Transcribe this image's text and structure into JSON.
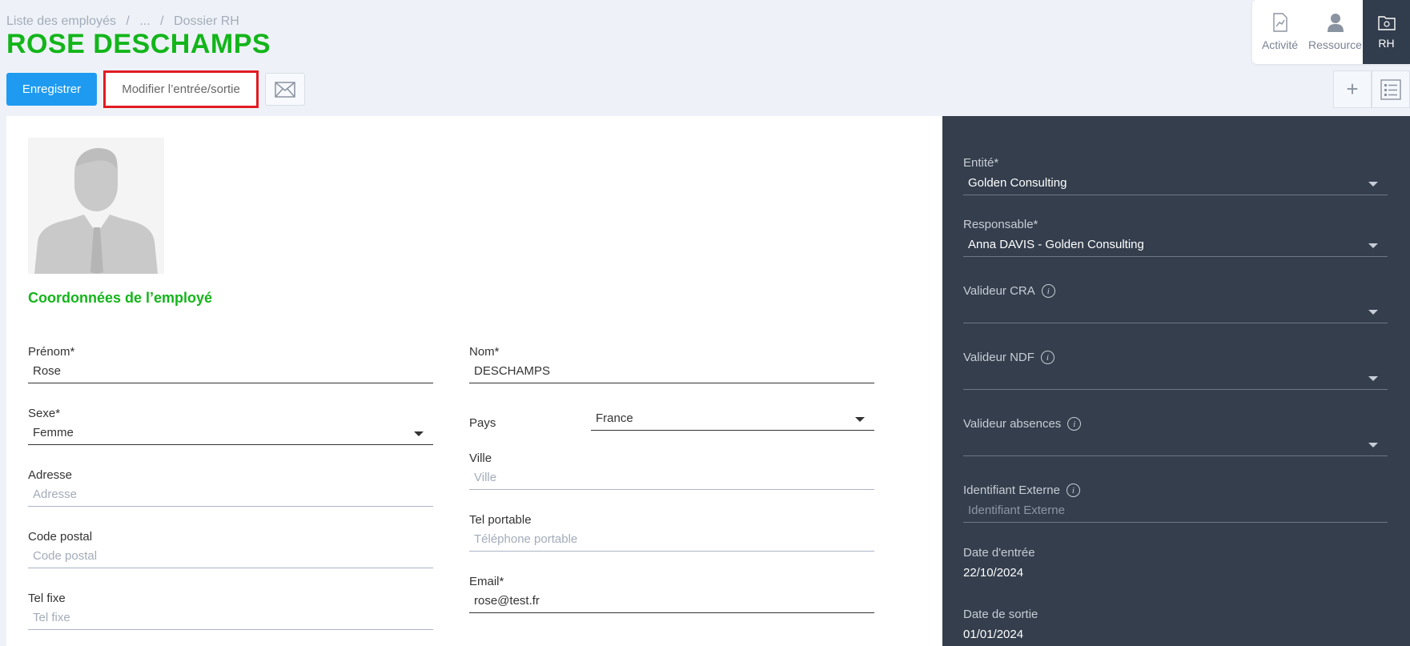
{
  "breadcrumb": {
    "item1": "Liste des employés",
    "sep1": "/",
    "item2": "...",
    "sep2": "/",
    "item3": "Dossier RH"
  },
  "page_title": "ROSE DESCHAMPS",
  "toolbar": {
    "save_label": "Enregistrer",
    "edit_label": "Modifier l’entrée/sortie"
  },
  "topnav": {
    "activite": "Activité",
    "ressource": "Ressource",
    "rh": "RH"
  },
  "tools": {
    "add": "+"
  },
  "section_title": "Coordonnées de l’employé",
  "form": {
    "prenom": {
      "label": "Prénom*",
      "value": "Rose"
    },
    "nom": {
      "label": "Nom*",
      "value": "DESCHAMPS"
    },
    "sexe": {
      "label": "Sexe*",
      "value": "Femme"
    },
    "pays": {
      "label": "Pays",
      "value": "France"
    },
    "adresse": {
      "label": "Adresse",
      "placeholder": "Adresse"
    },
    "ville": {
      "label": "Ville",
      "placeholder": "Ville"
    },
    "code_postal": {
      "label": "Code postal",
      "placeholder": "Code postal"
    },
    "tel_portable": {
      "label": "Tel portable",
      "placeholder": "Téléphone portable"
    },
    "tel_fixe": {
      "label": "Tel fixe",
      "placeholder": "Tel fixe"
    },
    "email": {
      "label": "Email*",
      "value": "rose@test.fr"
    }
  },
  "side": {
    "entite": {
      "label": "Entité*",
      "value": "Golden Consulting"
    },
    "responsable": {
      "label": "Responsable*",
      "value": "Anna DAVIS - Golden Consulting"
    },
    "valideur_cra": {
      "label": "Valideur CRA",
      "value": ""
    },
    "valideur_ndf": {
      "label": "Valideur NDF",
      "value": ""
    },
    "valideur_absences": {
      "label": "Valideur absences",
      "value": ""
    },
    "identifiant_externe": {
      "label": "Identifiant Externe",
      "placeholder": "Identifiant Externe"
    },
    "date_entree": {
      "label": "Date d'entrée",
      "value": "22/10/2024"
    },
    "date_sortie": {
      "label": "Date de sortie",
      "value": "01/01/2024"
    },
    "info_glyph": "i"
  },
  "colors": {
    "accent_green": "#13b51a",
    "primary_blue": "#1e9bf0",
    "side_panel": "#343e4d",
    "highlight_red": "#e21b23"
  }
}
